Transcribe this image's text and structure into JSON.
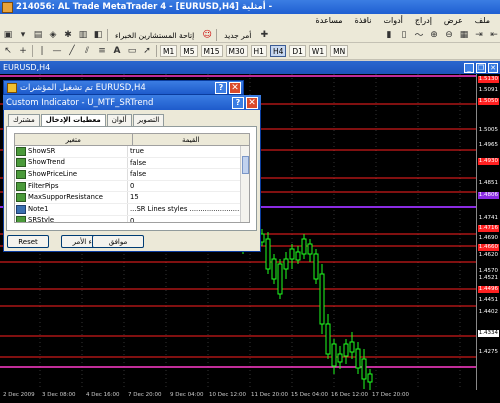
{
  "window": {
    "title": "214056: AL Trade MetaTrader 4 - [EURUSD,H4] أمثلية -"
  },
  "menu": [
    "ملف",
    "عرض",
    "إدراج",
    "أدوات",
    "نافذة",
    "مساعدة"
  ],
  "toolbar1": {
    "new_order": "أمر جديد",
    "experts": "إتاحة المستشارين الخبراء"
  },
  "toolbar2": {
    "timeframes": [
      "M1",
      "M5",
      "M15",
      "M30",
      "H1",
      "H4",
      "D1",
      "W1",
      "MN"
    ],
    "active": "H4"
  },
  "chart": {
    "title": "EURUSD,H4",
    "prices": [
      "1.5130",
      "1.5091",
      "1.5050",
      "1.5005",
      "1.4965",
      "1.4930",
      "1.4851",
      "1.4806",
      "1.4741",
      "1.4716",
      "1.4690",
      "1.4660",
      "1.4620",
      "1.4570",
      "1.4521",
      "1.4496",
      "1.4451",
      "1.4402",
      "1.4334",
      "1.4275"
    ],
    "times": [
      "2 Dec 2009",
      "3 Dec 08:00",
      "4 Dec 16:00",
      "7 Dec 20:00",
      "9 Dec 04:00",
      "10 Dec 12:00",
      "11 Dec 20:00",
      "15 Dec 04:00",
      "16 Dec 12:00",
      "17 Dec 20:00"
    ],
    "colors": {
      "red": "#ff2020",
      "magenta": "#ff3ccc",
      "purple": "#8a2be2",
      "candle": "#20ff20"
    }
  },
  "dialog1": {
    "title": "EURUSD,H4 تم تشغيل المؤشرات"
  },
  "dialog2": {
    "title": "Custom Indicator - U_MTF_SRTrend",
    "tabs": [
      "مشترك",
      "معطيات الإدخال",
      "ألوان",
      "التصوير"
    ],
    "active_tab": "معطيات الإدخال",
    "col_variable": "متغير",
    "col_value": "القيمة",
    "params": [
      {
        "name": "ShowSR",
        "value": "true",
        "icon": "bool"
      },
      {
        "name": "ShowTrend",
        "value": "false",
        "icon": "bool"
      },
      {
        "name": "ShowPriceLine",
        "value": "false",
        "icon": "bool"
      },
      {
        "name": "FilterPips",
        "value": "0",
        "icon": "int"
      },
      {
        "name": "MaxSupporResistance",
        "value": "15",
        "icon": "int"
      },
      {
        "name": "Note1",
        "value": "...SR Lines styles ..........................",
        "icon": "str"
      },
      {
        "name": "SRStyle",
        "value": "0",
        "icon": "int"
      }
    ],
    "buttons": {
      "reset": "Reset",
      "cancel": "إلغاء الأمر",
      "ok": "موافق"
    }
  }
}
